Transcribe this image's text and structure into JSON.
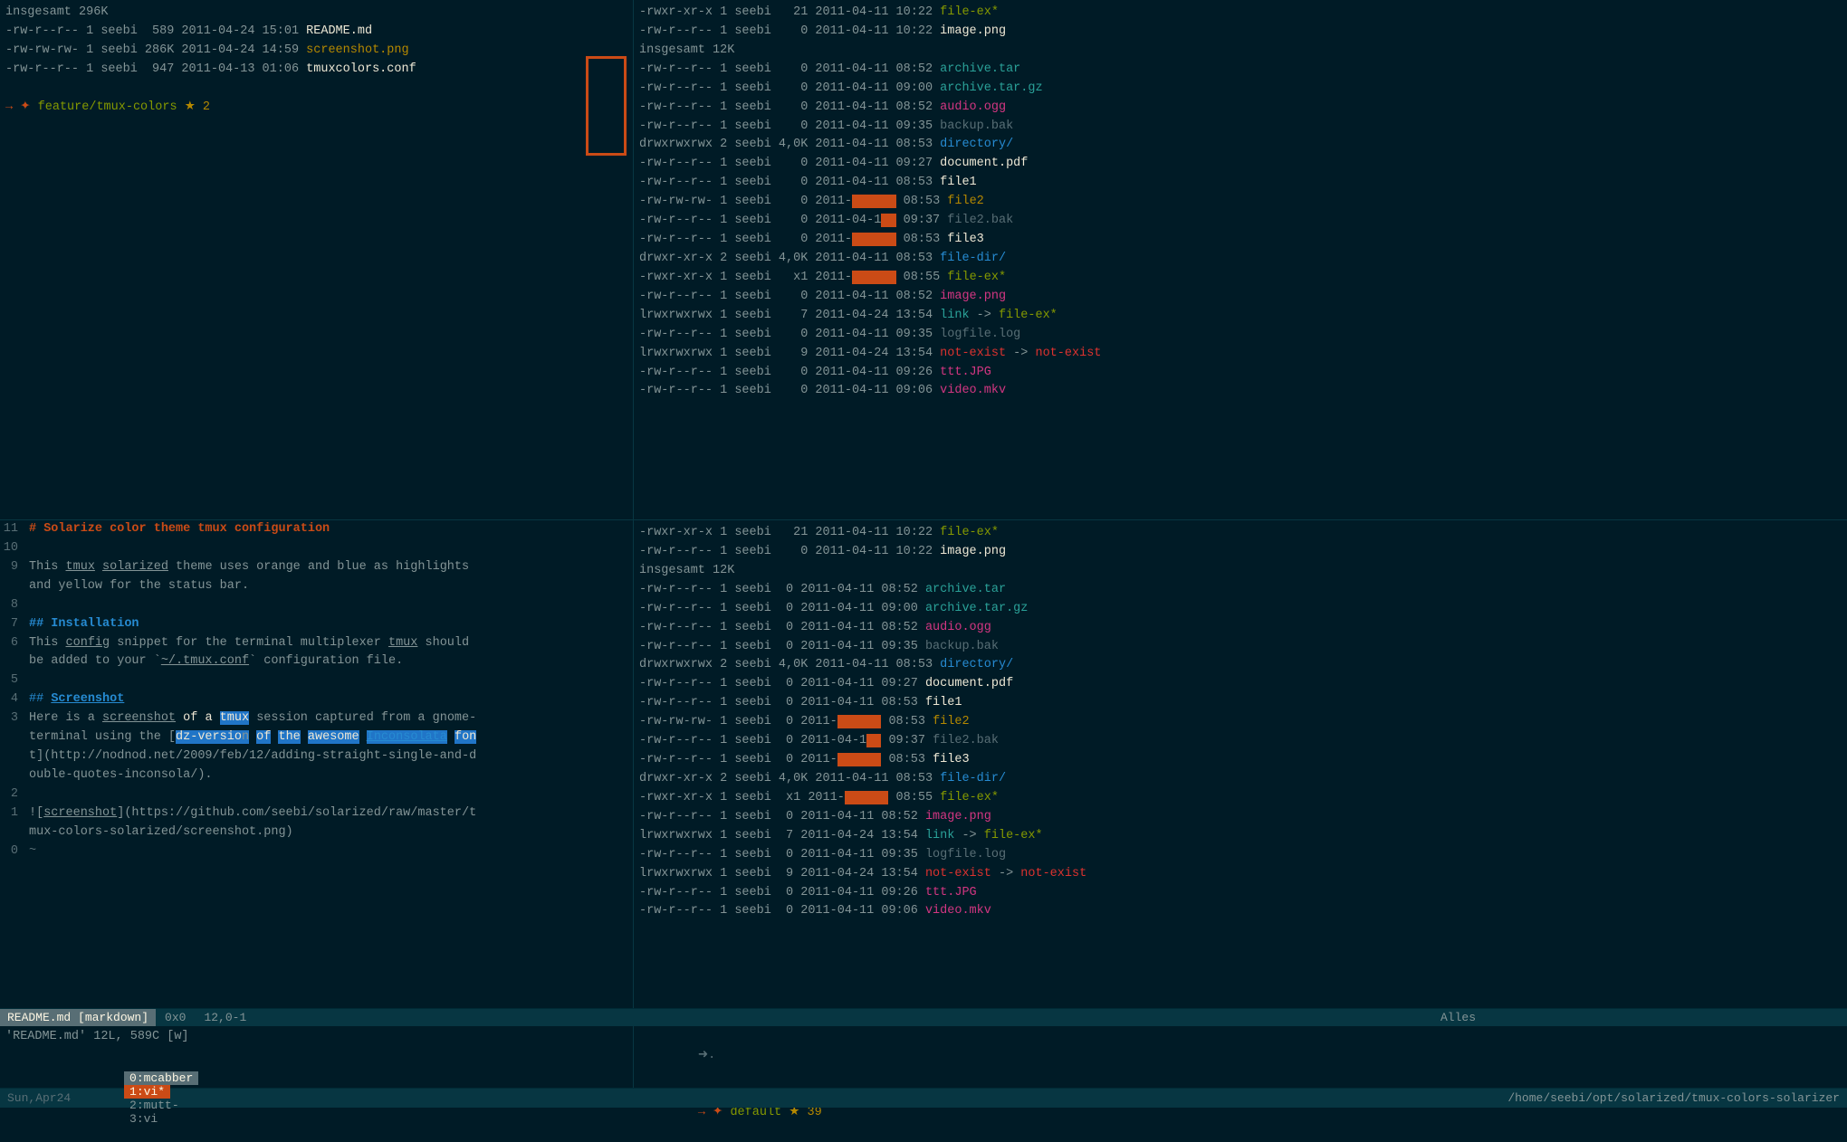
{
  "terminal": {
    "background": "#001b26",
    "top_left": {
      "lines": [
        "insgesamt 296K",
        "-rw-r--r-- 1 seebi  589 2011-04-24 15:01 README.md",
        "-rw-rw-rw- 1 seebi 286K 2011-04-24 14:59 screenshot.png",
        "-rw-r--r-- 1 seebi  947 2011-04-13 01:06 tmuxcolors.conf"
      ],
      "prompt": "➜ ✦ feature/tmux-colors ★ 2"
    },
    "top_right": {
      "lines": [
        "-rwxr-xr-x 1 seebi   21 2011-04-11 10:22 file-ex*",
        "-rw-r--r-- 1 seebi    0 2011-04-11 10:22 image.png",
        "insgesamt 12K",
        "-rw-r--r-- 1 seebi  0 2011-04-11 08:52 archive.tar",
        "-rw-r--r-- 1 seebi  0 2011-04-11 09:00 archive.tar.gz",
        "-rw-r--r-- 1 seebi  0 2011-04-11 08:52 audio.ogg",
        "-rw-r--r-- 1 seebi  0 2011-04-11 09:35 backup.bak",
        "drwxrwxrwx 2 seebi 4,0K 2011-04-11 08:53 directory/",
        "-rw-r--r-- 1 seebi  0 2011-04-11 09:27 document.pdf",
        "-rw-r--r-- 1 seebi  0 2011-04-11 08:53 file1",
        "-rw-rw-rw- 1 seebi  0 2011-       08:53 file2",
        "-rw-r--r-- 1 seebi  0 2011-04-1   09:37 file2.bak",
        "-rw-r--r-- 1 seebi  0 2011-       08:53 file3",
        "drwxr-xr-x 2 seebi 4,0K 2011-04-11 08:53 file-dir/",
        "-rwxr-xr-x 1 seebi  x1 2011-      08:55 file-ex*",
        "-rw-r--r-- 1 seebi  0 2011-04-11 08:52 image.png",
        "lrwxrwxrwx 1 seebi  7 2011-04-24 13:54 link -> file-ex*",
        "-rw-r--r-- 1 seebi  0 2011-04-11 09:35 logfile.log",
        "lrwxrwxrwx 1 seebi  9 2011-04-24 13:54 not-exist -> not-exist",
        "-rw-r--r-- 1 seebi  0 2011-04-11 09:26 ttt.JPG",
        "-rw-r--r-- 1 seebi  0 2011-04-11 09:06 video.mkv"
      ]
    },
    "editor": {
      "lines": [
        {
          "num": "11",
          "content": "# Solarize color theme tmux configuration"
        },
        {
          "num": "10",
          "content": ""
        },
        {
          "num": "9",
          "content": "This tmux solarized theme uses orange and blue as highlights"
        },
        {
          "num": "",
          "content": "and yellow for the status bar."
        },
        {
          "num": "8",
          "content": ""
        },
        {
          "num": "7",
          "content": "## Installation"
        },
        {
          "num": "6",
          "content": "This config snippet for the terminal multiplexer tmux should"
        },
        {
          "num": "",
          "content": "be added to your `~/.tmux.conf` configuration file."
        },
        {
          "num": "5",
          "content": ""
        },
        {
          "num": "4",
          "content": "## Screenshot"
        },
        {
          "num": "3",
          "content": "Here is a screenshot of a tmux session captured from a gnome-"
        },
        {
          "num": "",
          "content": "terminal using the [dz-version of the awesome Inconsolata fon"
        },
        {
          "num": "",
          "content": "t](http://nodnod.net/2009/feb/12/adding-straight-single-and-d"
        },
        {
          "num": "",
          "content": "ouble-quotes-inconsola/)."
        },
        {
          "num": "2",
          "content": ""
        },
        {
          "num": "1",
          "content": "![screenshot](https://github.com/seebi/solarized/raw/master/t"
        },
        {
          "num": "",
          "content": "mux-colors-solarized/screenshot.png)"
        },
        {
          "num": "0",
          "content": "~"
        }
      ]
    },
    "vim_status": {
      "filename": "README.md [markdown]",
      "pos": "0x0",
      "lineinfo": "12,0-1",
      "percent": "Alles"
    },
    "bottom_left": {
      "lines": [
        "'README.md' 12L, 589C [w]"
      ]
    },
    "bottom_right": {
      "prompt": "➜ ✦ default ★ 39"
    },
    "tmux_bar": {
      "tabs": [
        {
          "id": "0",
          "label": "mcabber",
          "active": false
        },
        {
          "id": "1",
          "label": "vi*",
          "active": true
        },
        {
          "id": "2",
          "label": "mutt-",
          "active": false
        },
        {
          "id": "3",
          "label": "vi",
          "active": false
        }
      ],
      "date": "Sun,Apr24",
      "time_left": "",
      "path": "/home/seebi/opt/solarized/tmux-colors-solarizer"
    }
  }
}
